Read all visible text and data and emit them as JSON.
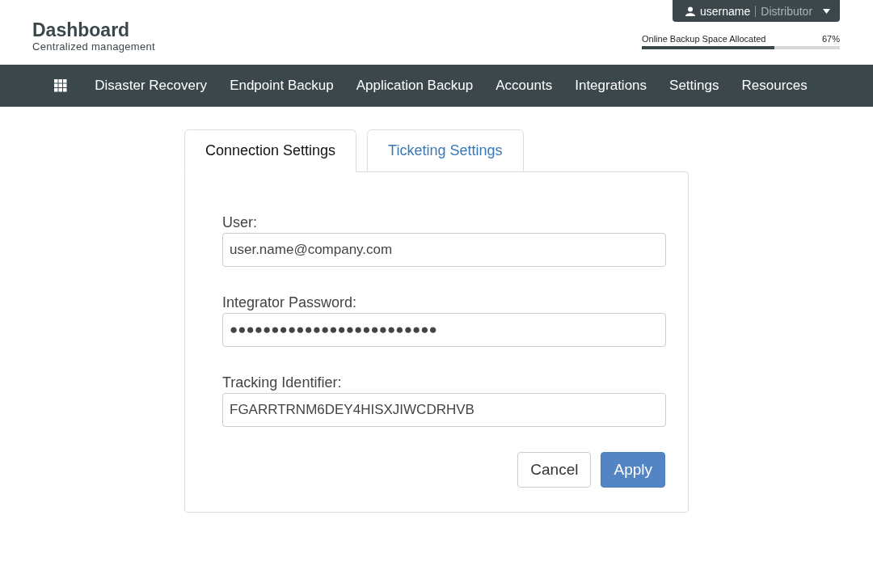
{
  "header": {
    "title": "Dashboard",
    "subtitle": "Centralized management",
    "user": {
      "name": "username",
      "role": "Distributor"
    },
    "storage": {
      "label": "Online Backup Space Allocated",
      "reading": "67%",
      "level": 0.67
    }
  },
  "nav": {
    "items": [
      "Disaster Recovery",
      "Endpoint Backup",
      "Application Backup",
      "Accounts",
      "Integrations",
      "Settings",
      "Resources"
    ]
  },
  "tabs": [
    {
      "label": "Connection Settings",
      "selected": true
    },
    {
      "label": "Ticketing Settings",
      "selected": false
    }
  ],
  "form": {
    "fields": [
      {
        "label": "User:",
        "value": "user.name@company.com"
      },
      {
        "label": "Integrator Password:",
        "value": "●●●●●●●●●●●●●●●●●●●●●●●●●"
      },
      {
        "label": "Tracking Identifier:",
        "value": "FGARRTRNM6DEY4HISXJIWCDRHVB"
      }
    ],
    "buttons": [
      {
        "label": "Cancel",
        "kind": "secondary"
      },
      {
        "label": "Apply",
        "kind": "primary"
      }
    ]
  }
}
